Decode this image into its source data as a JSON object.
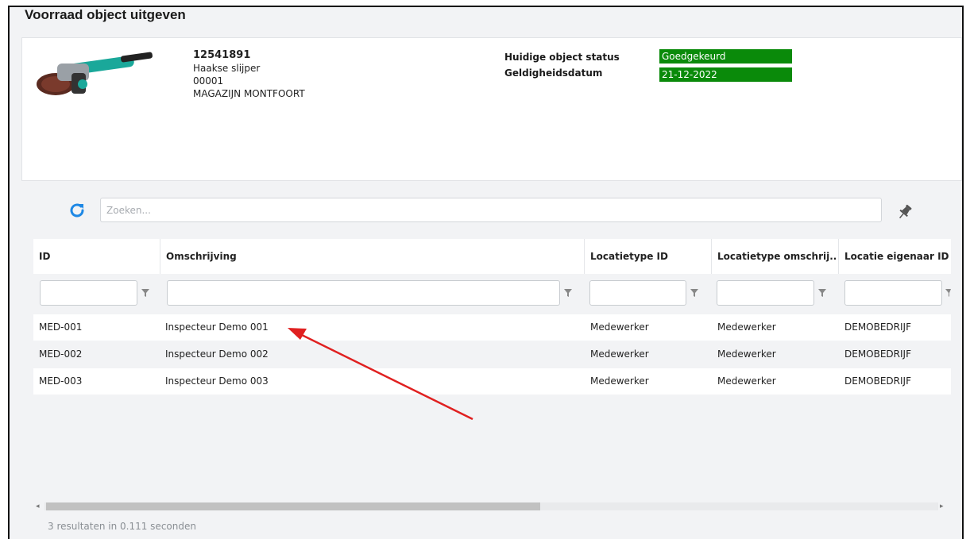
{
  "page": {
    "title": "Voorraad object uitgeven"
  },
  "object": {
    "image_icon": "angle-grinder-image",
    "code": "12541891",
    "name": "Haakse slijper",
    "number": "00001",
    "location": "MAGAZIJN MONTFOORT"
  },
  "status": {
    "label_status": "Huidige object status",
    "label_date": "Geldigheidsdatum",
    "value_status": "Goedgekeurd",
    "value_date": "21-12-2022",
    "badge_color": "#0a8a0a"
  },
  "toolbar": {
    "refresh_icon": "refresh-icon",
    "search_placeholder": "Zoeken...",
    "search_value": "",
    "pin_icon": "pin-icon",
    "accent_color": "#1e88e5"
  },
  "grid": {
    "columns": [
      "ID",
      "Omschrijving",
      "Locatietype ID",
      "Locatietype omschrij..",
      "Locatie eigenaar ID"
    ],
    "rows": [
      [
        "MED-001",
        "Inspecteur Demo 001",
        "Medewerker",
        "Medewerker",
        "DEMOBEDRIJF"
      ],
      [
        "MED-002",
        "Inspecteur Demo 002",
        "Medewerker",
        "Medewerker",
        "DEMOBEDRIJF"
      ],
      [
        "MED-003",
        "Inspecteur Demo 003",
        "Medewerker",
        "Medewerker",
        "DEMOBEDRIJF"
      ]
    ],
    "filter_icon": "filter-icon"
  },
  "footer": {
    "results": "3 resultaten in 0.111 seconden"
  },
  "annotation": {
    "arrow_color": "#e02020"
  }
}
